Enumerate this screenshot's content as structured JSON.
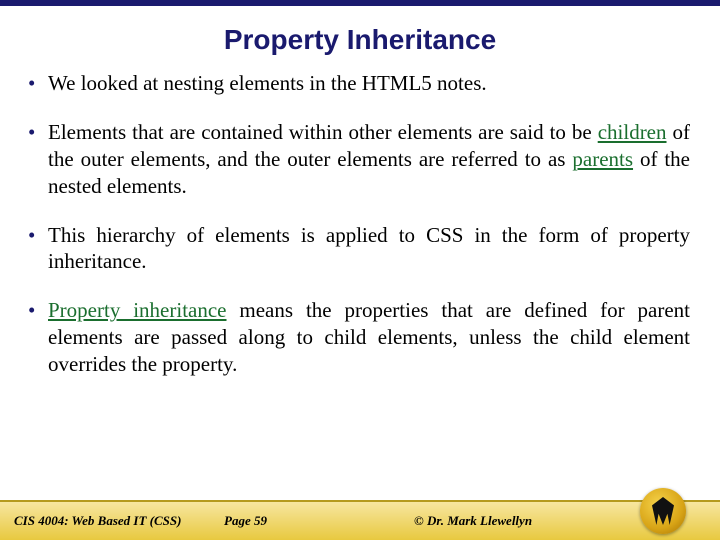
{
  "title": "Property Inheritance",
  "bullets": {
    "b1": "We looked at nesting elements in the HTML5 notes.",
    "b2a": "Elements that are contained within other elements are said to be ",
    "b2kw1": "children",
    "b2b": " of the outer elements, and the outer elements are referred to as ",
    "b2kw2": "parents",
    "b2c": " of the nested elements.",
    "b3": "This hierarchy of elements is applied to CSS in the form of property inheritance.",
    "b4kw": "Property inheritance",
    "b4a": " means the properties that are defined for parent elements are passed along to child elements, unless the child element overrides the property."
  },
  "footer": {
    "course": "CIS 4004: Web Based IT (CSS)",
    "page": "Page 59",
    "author": "© Dr. Mark Llewellyn"
  }
}
